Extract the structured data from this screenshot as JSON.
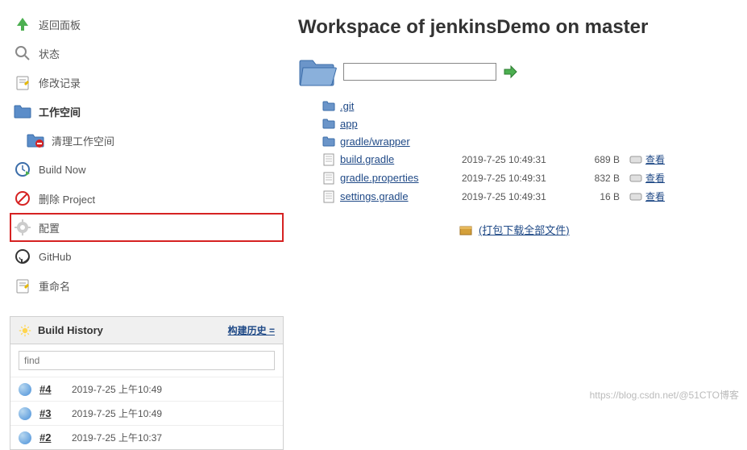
{
  "sidebar": {
    "items": [
      {
        "label": "返回面板"
      },
      {
        "label": "状态"
      },
      {
        "label": "修改记录"
      },
      {
        "label": "工作空间"
      },
      {
        "label": "清理工作空间"
      },
      {
        "label": "Build Now"
      },
      {
        "label": "删除 Project"
      },
      {
        "label": "配置"
      },
      {
        "label": "GitHub"
      },
      {
        "label": "重命名"
      }
    ]
  },
  "buildHistory": {
    "title": "Build History",
    "trendLabel": "构建历史 =",
    "searchPlaceholder": "find",
    "builds": [
      {
        "num": "#4",
        "date": "2019-7-25 上午10:49"
      },
      {
        "num": "#3",
        "date": "2019-7-25 上午10:49"
      },
      {
        "num": "#2",
        "date": "2019-7-25 上午10:37"
      }
    ]
  },
  "main": {
    "title": "Workspace of jenkinsDemo on master",
    "pathValue": "",
    "files": {
      "dirs": [
        {
          "name": ".git"
        },
        {
          "name": "app"
        },
        {
          "name": "gradle/wrapper"
        }
      ],
      "items": [
        {
          "name": "build.gradle",
          "date": "2019-7-25 10:49:31",
          "size": "689 B",
          "view": "查看"
        },
        {
          "name": "gradle.properties",
          "date": "2019-7-25 10:49:31",
          "size": "832 B",
          "view": "查看"
        },
        {
          "name": "settings.gradle",
          "date": "2019-7-25 10:49:31",
          "size": "16 B",
          "view": "查看"
        }
      ]
    },
    "downloadAll": "(打包下载全部文件)"
  },
  "watermark": "https://blog.csdn.net/@51CTO博客"
}
